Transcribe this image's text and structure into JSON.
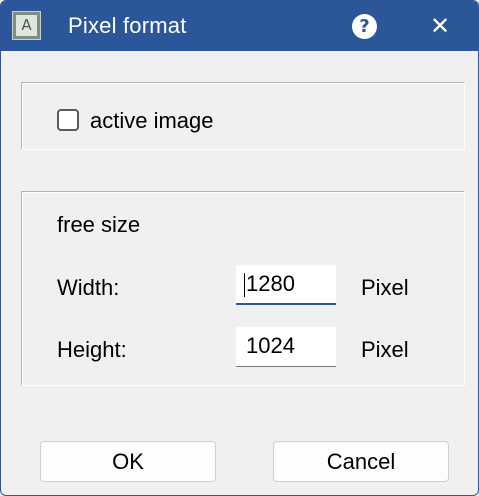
{
  "window": {
    "title": "Pixel format",
    "app_icon_glyph": "A",
    "help_glyph": "?",
    "close_glyph": "✕"
  },
  "active_group": {
    "checkbox_label": "active image",
    "checked": false
  },
  "size_group": {
    "heading": "free size",
    "width_label": "Width:",
    "width_value": "1280",
    "width_unit": "Pixel",
    "height_label": "Height:",
    "height_value": "1024",
    "height_unit": "Pixel"
  },
  "buttons": {
    "ok_label": "OK",
    "cancel_label": "Cancel"
  },
  "colors": {
    "titlebar": "#2b579a",
    "background": "#f0f0f0"
  }
}
